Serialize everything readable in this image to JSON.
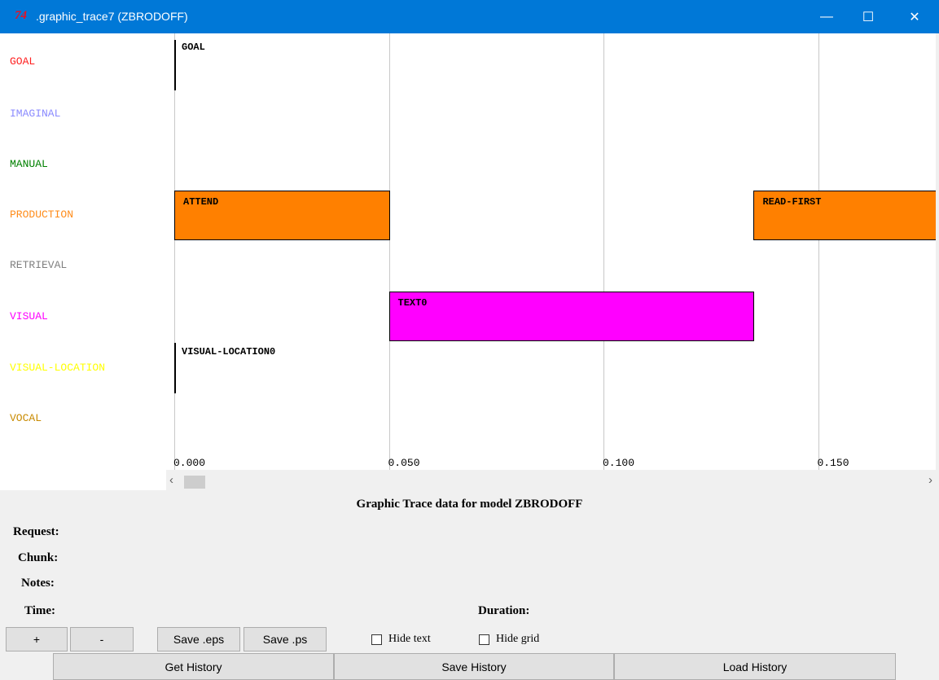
{
  "window": {
    "icon_text": "74",
    "title": ".graphic_trace7 (ZBRODOFF)",
    "minimize": "—",
    "maximize": "☐",
    "close": "✕"
  },
  "modules": [
    {
      "name": "GOAL",
      "color": "#ff2020"
    },
    {
      "name": "IMAGINAL",
      "color": "#8b8bff"
    },
    {
      "name": "MANUAL",
      "color": "#008000"
    },
    {
      "name": "PRODUCTION",
      "color": "#ff8c1a"
    },
    {
      "name": "RETRIEVAL",
      "color": "#808080"
    },
    {
      "name": "VISUAL",
      "color": "#ff00ff"
    },
    {
      "name": "VISUAL-LOCATION",
      "color": "#ffff00"
    },
    {
      "name": "VOCAL",
      "color": "#c88a00"
    }
  ],
  "chart_data": {
    "type": "gantt",
    "x_ticks": [
      "0.000",
      "0.050",
      "0.100",
      "0.150"
    ],
    "xlim": [
      0.0,
      0.175
    ],
    "grid": true,
    "boxes": [
      {
        "module": "PRODUCTION",
        "label": "ATTEND",
        "start": 0.0,
        "end": 0.05,
        "color": "#ff8000"
      },
      {
        "module": "PRODUCTION",
        "label": "READ-FIRST",
        "start": 0.135,
        "end": 0.185,
        "color": "#ff8000"
      },
      {
        "module": "VISUAL",
        "label": "TEXT0",
        "start": 0.05,
        "end": 0.135,
        "color": "#ff00ff"
      }
    ],
    "events": [
      {
        "module": "GOAL",
        "label": "GOAL",
        "time": 0.0
      },
      {
        "module": "VISUAL-LOCATION",
        "label": "VISUAL-LOCATION0",
        "time": 0.0
      }
    ]
  },
  "scroll": {
    "left": "‹",
    "right": "›"
  },
  "caption": "Graphic Trace data for model ZBRODOFF",
  "info": {
    "request": "Request:",
    "chunk": "Chunk:",
    "notes": "Notes:",
    "time": "Time:",
    "duration": "Duration:"
  },
  "controls": {
    "zoom_in": "+",
    "zoom_out": "-",
    "save_eps": "Save .eps",
    "save_ps": "Save .ps",
    "hide_text": "Hide text",
    "hide_grid": "Hide grid",
    "get_history": "Get History",
    "save_history": "Save History",
    "load_history": "Load History"
  }
}
